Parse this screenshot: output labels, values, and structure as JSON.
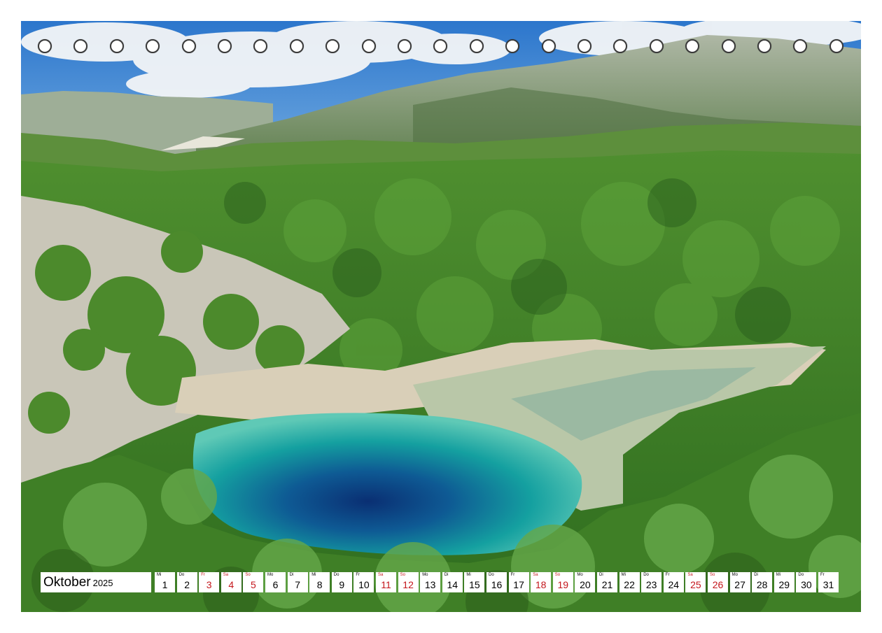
{
  "calendar": {
    "month": "Oktober",
    "year": "2025",
    "binding_holes": 23,
    "colors": {
      "weekend": "#c4161c",
      "weekday": "#000000",
      "cell": "#ffffff"
    },
    "days": [
      {
        "wd": "Mi",
        "n": "1",
        "weekend": false
      },
      {
        "wd": "Do",
        "n": "2",
        "weekend": false
      },
      {
        "wd": "Fr",
        "n": "3",
        "weekend": true
      },
      {
        "wd": "Sa",
        "n": "4",
        "weekend": true
      },
      {
        "wd": "So",
        "n": "5",
        "weekend": true
      },
      {
        "wd": "Mo",
        "n": "6",
        "weekend": false
      },
      {
        "wd": "Di",
        "n": "7",
        "weekend": false
      },
      {
        "wd": "Mi",
        "n": "8",
        "weekend": false
      },
      {
        "wd": "Do",
        "n": "9",
        "weekend": false
      },
      {
        "wd": "Fr",
        "n": "10",
        "weekend": false
      },
      {
        "wd": "Sa",
        "n": "11",
        "weekend": true
      },
      {
        "wd": "So",
        "n": "12",
        "weekend": true
      },
      {
        "wd": "Mo",
        "n": "13",
        "weekend": false
      },
      {
        "wd": "Di",
        "n": "14",
        "weekend": false
      },
      {
        "wd": "Mi",
        "n": "15",
        "weekend": false
      },
      {
        "wd": "Do",
        "n": "16",
        "weekend": false
      },
      {
        "wd": "Fr",
        "n": "17",
        "weekend": false
      },
      {
        "wd": "Sa",
        "n": "18",
        "weekend": true
      },
      {
        "wd": "So",
        "n": "19",
        "weekend": true
      },
      {
        "wd": "Mo",
        "n": "20",
        "weekend": false
      },
      {
        "wd": "Di",
        "n": "21",
        "weekend": false
      },
      {
        "wd": "Mi",
        "n": "22",
        "weekend": false
      },
      {
        "wd": "Do",
        "n": "23",
        "weekend": false
      },
      {
        "wd": "Fr",
        "n": "24",
        "weekend": false
      },
      {
        "wd": "Sa",
        "n": "25",
        "weekend": true
      },
      {
        "wd": "So",
        "n": "26",
        "weekend": true
      },
      {
        "wd": "Mo",
        "n": "27",
        "weekend": false
      },
      {
        "wd": "Di",
        "n": "28",
        "weekend": false
      },
      {
        "wd": "Mi",
        "n": "29",
        "weekend": false
      },
      {
        "wd": "Do",
        "n": "30",
        "weekend": false
      },
      {
        "wd": "Fr",
        "n": "31",
        "weekend": false
      }
    ]
  },
  "photo": {
    "subject": "turquoise spring pool surrounded by green forest and limestone mountains",
    "colors": {
      "sky": "#2f7fd0",
      "forest": "#3f8a2a",
      "water": "#1aa7a3",
      "deep_water": "#0b3f7a",
      "rock": "#cfcbbf"
    }
  }
}
